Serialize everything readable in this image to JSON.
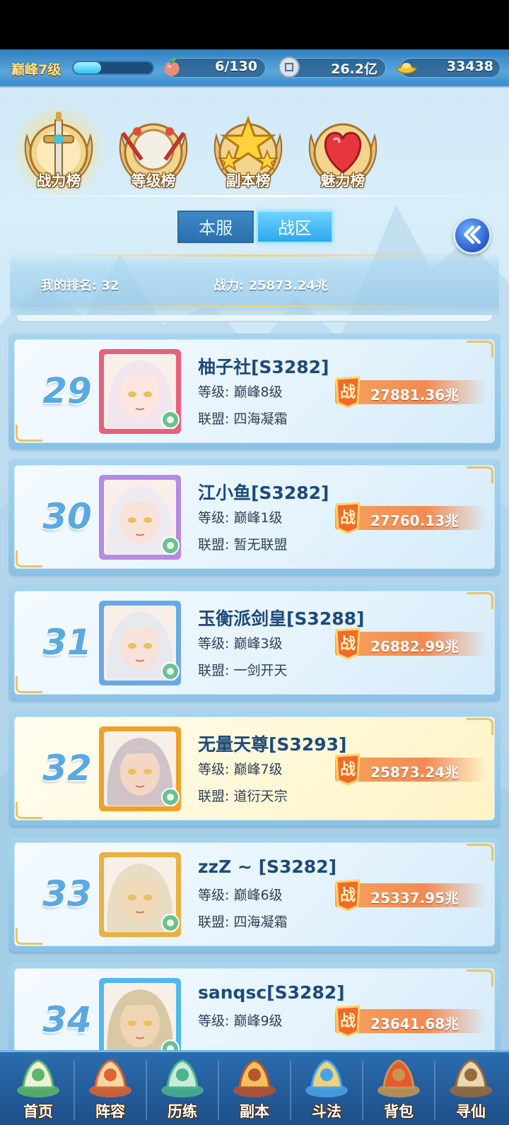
{
  "topbar": {
    "level_label": "巅峰7级",
    "level_progress": 0.35,
    "stamina": "6/130",
    "silver": "26.2亿",
    "gold": "33438"
  },
  "tabs": [
    {
      "label": "战力榜",
      "icon": "sword-medal-icon",
      "active": true
    },
    {
      "label": "等级榜",
      "icon": "drum-medal-icon",
      "active": false
    },
    {
      "label": "副本榜",
      "icon": "star-medal-icon",
      "active": false
    },
    {
      "label": "魅力榜",
      "icon": "heart-medal-icon",
      "active": false
    }
  ],
  "server_toggle": {
    "local": "本服",
    "zone": "战区",
    "selected": "战区"
  },
  "my_rank": {
    "rank_text": "我的排名: 32",
    "power_text": "战力: 25873.24兆"
  },
  "rankings": [
    {
      "rank": "29",
      "name": "柚子社[S3282]",
      "level": "等级: 巅峰8级",
      "guild": "联盟: 四海凝霜",
      "power": "27881.36兆",
      "highlight": false,
      "frame": "#e8607a",
      "hair": "#f1e6ee",
      "skin": "#fde5e0"
    },
    {
      "rank": "30",
      "name": "江小鱼[S3282]",
      "level": "等级: 巅峰1级",
      "guild": "联盟: 暂无联盟",
      "power": "27760.13兆",
      "highlight": false,
      "frame": "#b38be3",
      "hair": "#eeeaf2",
      "skin": "#f7e3da"
    },
    {
      "rank": "31",
      "name": "玉衡派剑皇[S3288]",
      "level": "等级: 巅峰3级",
      "guild": "联盟: 一剑开天",
      "power": "26882.99兆",
      "highlight": false,
      "frame": "#6aa8e8",
      "hair": "#e7e9ee",
      "skin": "#f6e2d8"
    },
    {
      "rank": "32",
      "name": "无量天尊[S3293]",
      "level": "等级: 巅峰7级",
      "guild": "联盟: 道衍天宗",
      "power": "25873.24兆",
      "highlight": true,
      "frame": "#f0a02a",
      "hair": "#cfc3c8",
      "skin": "#f4d6c4"
    },
    {
      "rank": "33",
      "name": "zzZ ~ [S3282]",
      "level": "等级: 巅峰6级",
      "guild": "联盟: 四海凝霜",
      "power": "25337.95兆",
      "highlight": false,
      "frame": "#e9b043",
      "hair": "#e8dcc2",
      "skin": "#f1d8b9"
    },
    {
      "rank": "34",
      "name": "sanqsc[S3282]",
      "level": "等级: 巅峰9级",
      "guild": "",
      "power": "23641.68兆",
      "highlight": false,
      "frame": "#4fb8f0",
      "hair": "#d8c8a4",
      "skin": "#f0d5b5"
    }
  ],
  "nav": [
    {
      "label": "首页",
      "icon": "home-island-icon"
    },
    {
      "label": "阵容",
      "icon": "lineup-cards-icon"
    },
    {
      "label": "历练",
      "icon": "training-gourd-icon"
    },
    {
      "label": "副本",
      "icon": "dungeon-gate-icon"
    },
    {
      "label": "斗法",
      "icon": "battle-sword-icon"
    },
    {
      "label": "背包",
      "icon": "backpack-icon"
    },
    {
      "label": "寻仙",
      "icon": "seek-scroll-icon"
    }
  ],
  "colors": {
    "accent_blue": "#2ea8ee",
    "power_orange": "#f28b54",
    "rank_num": "#5aa9e2",
    "gold_trim": "#e8c56a"
  }
}
